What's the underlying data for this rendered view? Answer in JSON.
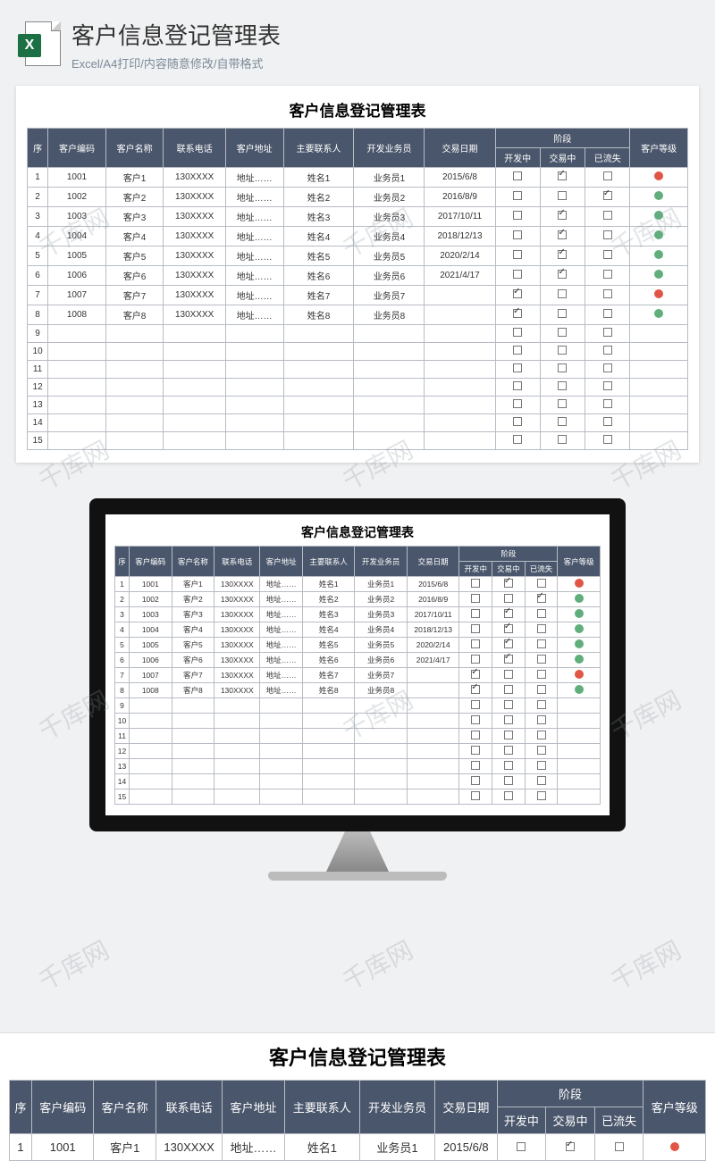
{
  "header": {
    "title": "客户信息登记管理表",
    "subtitle": "Excel/A4打印/内容随意修改/自带格式",
    "icon_letter": "X"
  },
  "table": {
    "title": "客户信息登记管理表",
    "columns": {
      "seq": "序",
      "code": "客户编码",
      "name": "客户名称",
      "phone": "联系电话",
      "addr": "客户地址",
      "contact": "主要联系人",
      "sales": "开发业务员",
      "date": "交易日期",
      "stage_group": "阶段",
      "stage_dev": "开发中",
      "stage_deal": "交易中",
      "stage_lost": "已流失",
      "level": "客户等级"
    },
    "rows": [
      {
        "seq": "1",
        "code": "1001",
        "name": "客户1",
        "phone": "130XXXX",
        "addr": "地址……",
        "contact": "姓名1",
        "sales": "业务员1",
        "date": "2015/6/8",
        "dev": false,
        "deal": true,
        "lost": false,
        "level": "red"
      },
      {
        "seq": "2",
        "code": "1002",
        "name": "客户2",
        "phone": "130XXXX",
        "addr": "地址……",
        "contact": "姓名2",
        "sales": "业务员2",
        "date": "2016/8/9",
        "dev": false,
        "deal": false,
        "lost": true,
        "level": "green"
      },
      {
        "seq": "3",
        "code": "1003",
        "name": "客户3",
        "phone": "130XXXX",
        "addr": "地址……",
        "contact": "姓名3",
        "sales": "业务员3",
        "date": "2017/10/11",
        "dev": false,
        "deal": true,
        "lost": false,
        "level": "green"
      },
      {
        "seq": "4",
        "code": "1004",
        "name": "客户4",
        "phone": "130XXXX",
        "addr": "地址……",
        "contact": "姓名4",
        "sales": "业务员4",
        "date": "2018/12/13",
        "dev": false,
        "deal": true,
        "lost": false,
        "level": "green"
      },
      {
        "seq": "5",
        "code": "1005",
        "name": "客户5",
        "phone": "130XXXX",
        "addr": "地址……",
        "contact": "姓名5",
        "sales": "业务员5",
        "date": "2020/2/14",
        "dev": false,
        "deal": true,
        "lost": false,
        "level": "green"
      },
      {
        "seq": "6",
        "code": "1006",
        "name": "客户6",
        "phone": "130XXXX",
        "addr": "地址……",
        "contact": "姓名6",
        "sales": "业务员6",
        "date": "2021/4/17",
        "dev": false,
        "deal": true,
        "lost": false,
        "level": "green"
      },
      {
        "seq": "7",
        "code": "1007",
        "name": "客户7",
        "phone": "130XXXX",
        "addr": "地址……",
        "contact": "姓名7",
        "sales": "业务员7",
        "date": "",
        "dev": true,
        "deal": false,
        "lost": false,
        "level": "red"
      },
      {
        "seq": "8",
        "code": "1008",
        "name": "客户8",
        "phone": "130XXXX",
        "addr": "地址……",
        "contact": "姓名8",
        "sales": "业务员8",
        "date": "",
        "dev": true,
        "deal": false,
        "lost": false,
        "level": "green"
      },
      {
        "seq": "9",
        "code": "",
        "name": "",
        "phone": "",
        "addr": "",
        "contact": "",
        "sales": "",
        "date": "",
        "dev": false,
        "deal": false,
        "lost": false,
        "level": ""
      },
      {
        "seq": "10",
        "code": "",
        "name": "",
        "phone": "",
        "addr": "",
        "contact": "",
        "sales": "",
        "date": "",
        "dev": false,
        "deal": false,
        "lost": false,
        "level": ""
      },
      {
        "seq": "11",
        "code": "",
        "name": "",
        "phone": "",
        "addr": "",
        "contact": "",
        "sales": "",
        "date": "",
        "dev": false,
        "deal": false,
        "lost": false,
        "level": ""
      },
      {
        "seq": "12",
        "code": "",
        "name": "",
        "phone": "",
        "addr": "",
        "contact": "",
        "sales": "",
        "date": "",
        "dev": false,
        "deal": false,
        "lost": false,
        "level": ""
      },
      {
        "seq": "13",
        "code": "",
        "name": "",
        "phone": "",
        "addr": "",
        "contact": "",
        "sales": "",
        "date": "",
        "dev": false,
        "deal": false,
        "lost": false,
        "level": ""
      },
      {
        "seq": "14",
        "code": "",
        "name": "",
        "phone": "",
        "addr": "",
        "contact": "",
        "sales": "",
        "date": "",
        "dev": false,
        "deal": false,
        "lost": false,
        "level": ""
      },
      {
        "seq": "15",
        "code": "",
        "name": "",
        "phone": "",
        "addr": "",
        "contact": "",
        "sales": "",
        "date": "",
        "dev": false,
        "deal": false,
        "lost": false,
        "level": ""
      }
    ]
  },
  "watermark": "千库网"
}
